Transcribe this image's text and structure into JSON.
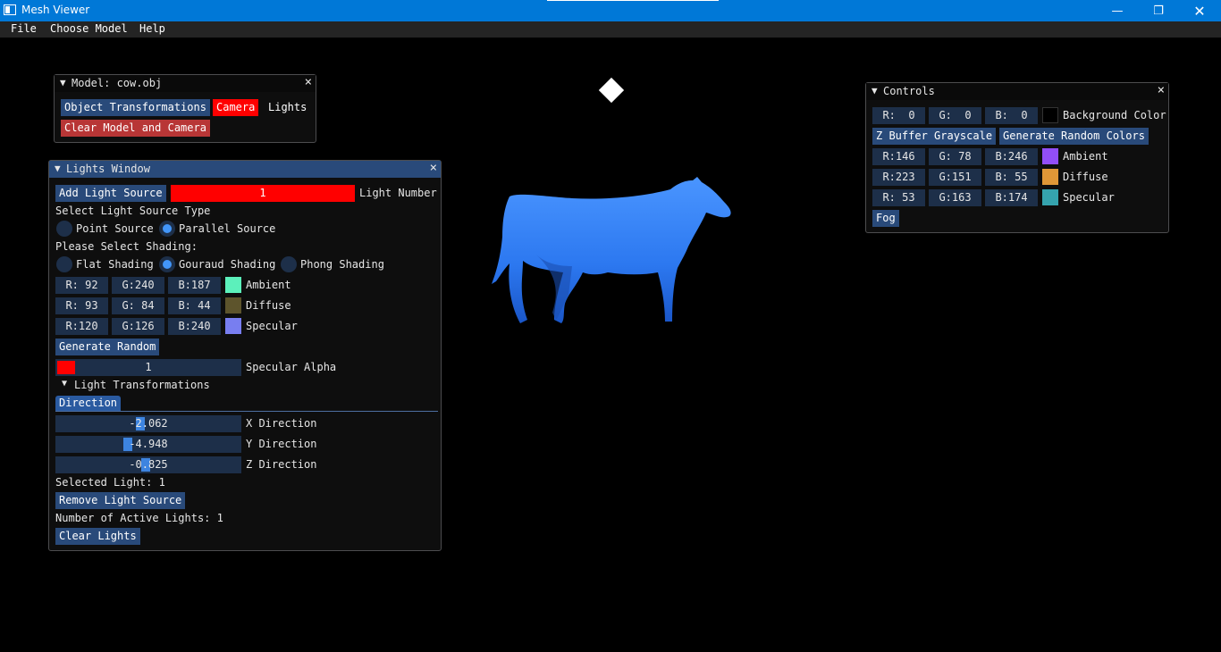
{
  "window": {
    "title": "Mesh Viewer",
    "minimize": "—",
    "maximize": "❐",
    "close": "✕"
  },
  "menu": {
    "items": [
      "File",
      "Choose Model",
      "Help"
    ]
  },
  "model_panel": {
    "title": "Model: cow.obj",
    "object_transformations": "Object Transformations",
    "camera": "Camera",
    "lights": "Lights",
    "clear": "Clear Model and Camera"
  },
  "lights_panel": {
    "title": "Lights Window",
    "add_light": "Add Light Source",
    "light_number_value": "1",
    "light_number_label": "Light Number",
    "select_type": "Select Light Source Type",
    "point_source": "Point Source",
    "parallel_source": "Parallel Source",
    "select_shading": "Please Select Shading:",
    "flat": "Flat Shading",
    "gouraud": "Gouraud Shading",
    "phong": "Phong Shading",
    "ambient": {
      "r": "R: 92",
      "g": "G:240",
      "b": "B:187",
      "color": "#5cf0bb",
      "label": "Ambient"
    },
    "diffuse": {
      "r": "R: 93",
      "g": "G: 84",
      "b": "B: 44",
      "color": "#5d542c",
      "label": "Diffuse"
    },
    "specular": {
      "r": "R:120",
      "g": "G:126",
      "b": "B:240",
      "color": "#787ef0",
      "label": "Specular"
    },
    "generate_random": "Generate Random",
    "specular_alpha_value": "1",
    "specular_alpha_label": "Specular Alpha",
    "light_transformations": "Light Transformations",
    "direction_tab": "Direction",
    "x_dir": {
      "value": "-2.062",
      "label": "X Direction"
    },
    "y_dir": {
      "value": "-4.948",
      "label": "Y Direction"
    },
    "z_dir": {
      "value": "-0.825",
      "label": "Z Direction"
    },
    "selected_light": "Selected Light: 1",
    "remove_light": "Remove Light Source",
    "active_lights": "Number of Active Lights: 1",
    "clear_lights": "Clear Lights"
  },
  "controls_panel": {
    "title": "Controls",
    "background": {
      "r": "R:  0",
      "g": "G:  0",
      "b": "B:  0",
      "color": "#000000",
      "label": "Background Color"
    },
    "zbuffer": "Z Buffer Grayscale",
    "random_colors": "Generate Random Colors",
    "ambient": {
      "r": "R:146",
      "g": "G: 78",
      "b": "B:246",
      "color": "#924ef6",
      "label": "Ambient"
    },
    "diffuse": {
      "r": "R:223",
      "g": "G:151",
      "b": "B: 55",
      "color": "#df9737",
      "label": "Diffuse"
    },
    "specular": {
      "r": "R: 53",
      "g": "G:163",
      "b": "B:174",
      "color": "#35a3ae",
      "label": "Specular"
    },
    "fog": "Fog"
  },
  "colors": {
    "titlebar": "#0078d7",
    "button": "#294a7a",
    "frame": "#1d2f49",
    "cow": "#2e7bf0"
  }
}
